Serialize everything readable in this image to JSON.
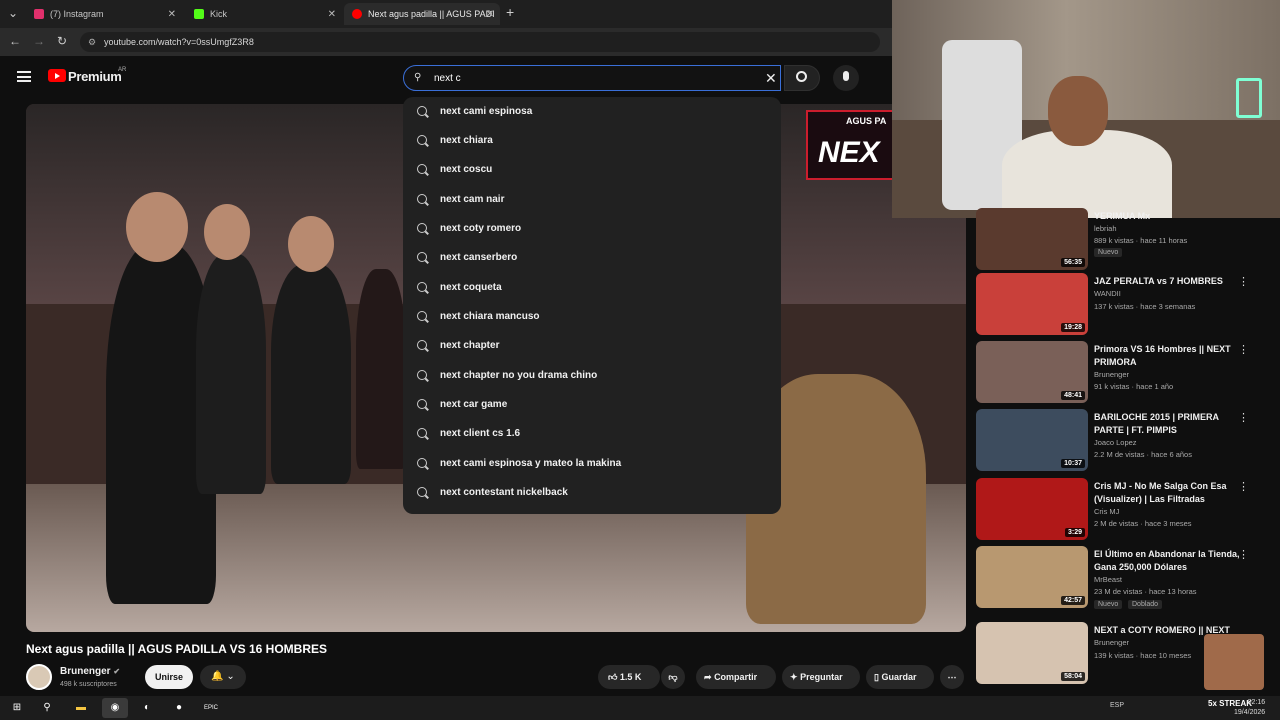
{
  "browser": {
    "tabs": [
      {
        "title": "(7) Instagram",
        "favicon_color": "#e1306c"
      },
      {
        "title": "Kick",
        "favicon_color": "#53fc18"
      },
      {
        "title": "Next agus padilla || AGUS PADI",
        "favicon_color": "#ff0000"
      }
    ],
    "new_tab": "+",
    "url": "youtube.com/watch?v=0ssUmgfZ3R8"
  },
  "header": {
    "brand": "Premium",
    "region": "AR",
    "search_value": "next c"
  },
  "suggestions": [
    "next cami espinosa",
    "next chiara",
    "next coscu",
    "next cam nair",
    "next coty romero",
    "next canserbero",
    "next coqueta",
    "next chiara mancuso",
    "next chapter",
    "next chapter no you drama chino",
    "next car game",
    "next client cs 1.6",
    "next cami espinosa y mateo la makina",
    "next contestant nickelback"
  ],
  "player": {
    "overlay_brand": "NEX",
    "overlay_small": "AGUS PA"
  },
  "video": {
    "title": "Next agus padilla || AGUS PADILLA VS 16 HOMBRES",
    "channel": "Brunenger",
    "subscribers": "498 k suscriptores",
    "join_label": "Unirse",
    "likes": "1.5 K",
    "share_label": "Compartir",
    "ask_label": "Preguntar",
    "save_label": "Guardar"
  },
  "recommendations": [
    {
      "title": "YERIMUA Mx",
      "channel": "lebriah",
      "meta": "889 k vistas · hace 11 horas",
      "badge": "Nuevo",
      "duration": "56:35"
    },
    {
      "title": "JAZ PERALTA vs 7 HOMBRES",
      "channel": "WANDII",
      "meta": "137 k vistas · hace 3 semanas",
      "badge": "",
      "duration": "19:28"
    },
    {
      "title": "Primora VS 16 Hombres || NEXT PRIMORA",
      "channel": "Brunenger",
      "meta": "91 k vistas · hace 1 año",
      "badge": "",
      "duration": "48:41"
    },
    {
      "title": "BARILOCHE 2015 | PRIMERA PARTE | FT. PIMPIS",
      "channel": "Joaco Lopez",
      "meta": "2.2 M de vistas · hace 6 años",
      "badge": "",
      "duration": "10:37"
    },
    {
      "title": "Cris MJ - No Me Salga Con Esa (Visualizer) | Las Filtradas",
      "channel": "Cris MJ",
      "meta": "2 M de vistas · hace 3 meses",
      "badge": "",
      "duration": "3:29"
    },
    {
      "title": "El Último en Abandonar la Tienda, Gana 250,000 Dólares",
      "channel": "MrBeast",
      "meta": "23 M de vistas · hace 13 horas",
      "badge": "Nuevo",
      "badge2": "Doblado",
      "duration": "42:57"
    },
    {
      "title": "NEXT a COTY ROMERO || NEXT",
      "channel": "Brunenger",
      "meta": "139 k vistas · hace 10 meses",
      "badge": "",
      "duration": "58:04"
    }
  ],
  "thumb_colors": [
    "#5a3a2e",
    "#c9403a",
    "#7a6058",
    "#3d4c5e",
    "#b01818",
    "#b89870",
    "#d6c3b0"
  ],
  "taskbar": {
    "streak": "5x STREAK",
    "time": "02:16",
    "date": "19/4/2026",
    "lang": "ESP"
  },
  "colors": {
    "accent": "#ff0000",
    "search_border": "#3a6fd8"
  }
}
